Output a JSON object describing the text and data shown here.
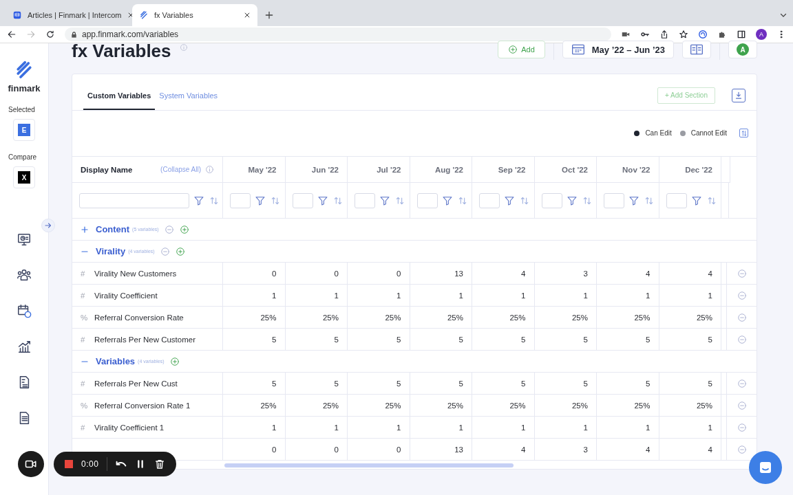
{
  "browser": {
    "tabs": [
      {
        "title": "Articles | Finmark | Intercom",
        "selected": false,
        "kind": "intercom"
      },
      {
        "title": "fx Variables",
        "selected": true,
        "kind": "finmark"
      }
    ],
    "url": "app.finmark.com/variables",
    "profile": "A"
  },
  "sidebar": {
    "brand": "finmark",
    "selected_label": "Selected",
    "selected_badge": "E",
    "compare_label": "Compare",
    "compare_badge": "X",
    "nav": [
      {
        "kind": "monitor",
        "selected": false
      },
      {
        "kind": "people",
        "selected": false
      },
      {
        "kind": "calendar",
        "selected": false
      },
      {
        "kind": "chart",
        "selected": false
      },
      {
        "kind": "invoice",
        "selected": false
      },
      {
        "kind": "document",
        "selected": false
      }
    ]
  },
  "header": {
    "title": "fx Variables",
    "add_button": "Add",
    "date_range": "May ’22 – Jun ’23",
    "avatar": "A"
  },
  "card": {
    "tabs": [
      {
        "label": "Custom Variables",
        "selected": true
      },
      {
        "label": "System Variables",
        "selected": false
      }
    ],
    "add_section": "+ Add Section",
    "legend": [
      {
        "label": "Can Edit",
        "color": "#1f2430"
      },
      {
        "label": "Cannot Edit",
        "color": "#9a9ca3"
      }
    ],
    "table": {
      "name_header": "Display Name",
      "collapse_all": "(Collapse All)",
      "columns": [
        "May '22",
        "Jun '22",
        "Jul '22",
        "Aug '22",
        "Sep '22",
        "Oct '22",
        "Nov '22",
        "Dec '22"
      ],
      "rows": [
        {
          "kind": "group",
          "name": "Content",
          "count": "(5 variables)",
          "expanded": false,
          "removable": true
        },
        {
          "kind": "group",
          "name": "Virality",
          "count": "(4 variables)",
          "expanded": true,
          "removable": true
        },
        {
          "kind": "data",
          "symbol": "#",
          "name": "Virality New Customers",
          "values": [
            "0",
            "0",
            "0",
            "13",
            "4",
            "3",
            "4",
            "4"
          ]
        },
        {
          "kind": "data",
          "symbol": "#",
          "name": "Virality Coefficient",
          "values": [
            "1",
            "1",
            "1",
            "1",
            "1",
            "1",
            "1",
            "1"
          ]
        },
        {
          "kind": "data",
          "symbol": "%",
          "name": "Referral Conversion Rate",
          "values": [
            "25%",
            "25%",
            "25%",
            "25%",
            "25%",
            "25%",
            "25%",
            "25%"
          ]
        },
        {
          "kind": "data",
          "symbol": "#",
          "name": "Referrals Per New Customer",
          "values": [
            "5",
            "5",
            "5",
            "5",
            "5",
            "5",
            "5",
            "5"
          ]
        },
        {
          "kind": "group",
          "name": "Variables",
          "count": "(4 variables)",
          "expanded": true,
          "removable": false
        },
        {
          "kind": "data",
          "symbol": "#",
          "name": "Referrals Per New Cust",
          "values": [
            "5",
            "5",
            "5",
            "5",
            "5",
            "5",
            "5",
            "5"
          ]
        },
        {
          "kind": "data",
          "symbol": "%",
          "name": "Referral Conversion Rate 1",
          "values": [
            "25%",
            "25%",
            "25%",
            "25%",
            "25%",
            "25%",
            "25%",
            "25%"
          ]
        },
        {
          "kind": "data",
          "symbol": "#",
          "name": "Virality Coefficient 1",
          "values": [
            "1",
            "1",
            "1",
            "1",
            "1",
            "1",
            "1",
            "1"
          ]
        },
        {
          "kind": "data",
          "values": [
            "0",
            "0",
            "0",
            "13",
            "4",
            "3",
            "4",
            "4"
          ]
        }
      ]
    }
  },
  "recorder": {
    "time": "0:00"
  }
}
